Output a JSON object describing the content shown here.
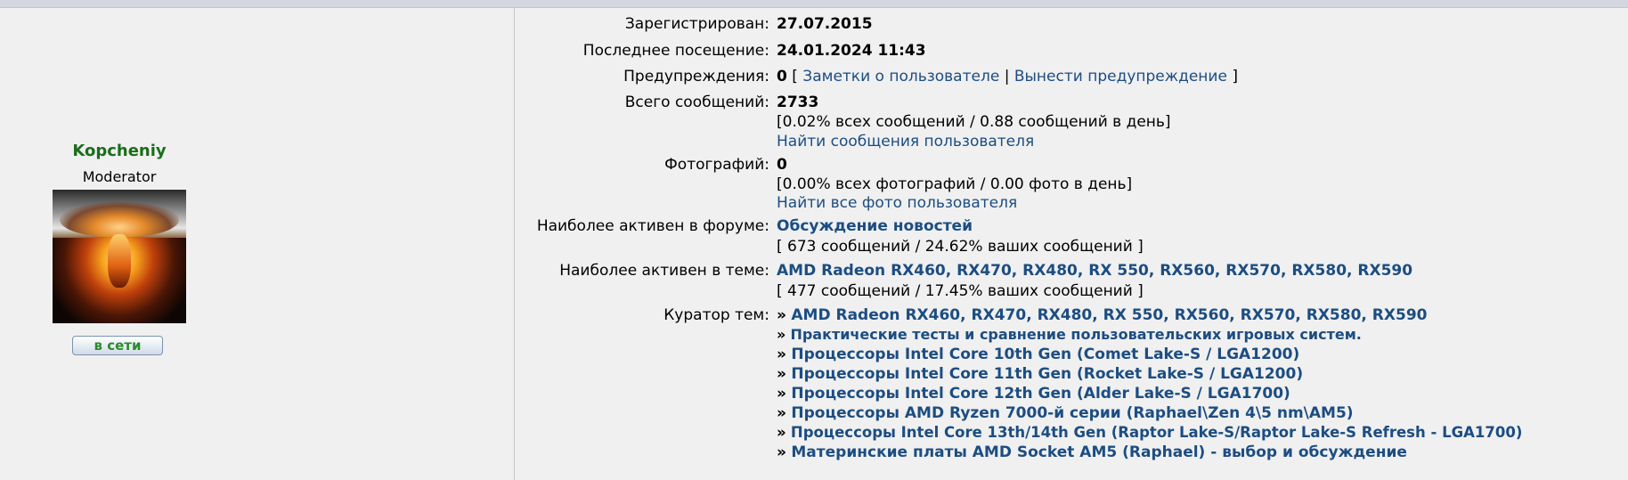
{
  "profile": {
    "username": "Kopcheniy",
    "rank": "Moderator",
    "online_label": "в сети"
  },
  "fields": {
    "registered": {
      "label": "Зарегистрирован:",
      "value": "27.07.2015"
    },
    "last_visit": {
      "label": "Последнее посещение:",
      "value": "24.01.2024 11:43"
    },
    "warnings": {
      "label": "Предупреждения:",
      "value": "0",
      "bracket_open": "[",
      "notes_link": "Заметки о пользователе",
      "separator": "|",
      "warn_link": "Вынести предупреждение",
      "bracket_close": "]"
    },
    "posts": {
      "label": "Всего сообщений:",
      "value": "2733",
      "stats": "[0.02% всех сообщений / 0.88 сообщений в день]",
      "find_link": "Найти сообщения пользователя"
    },
    "photos": {
      "label": "Фотографий:",
      "value": "0",
      "stats": "[0.00% всех фотографий / 0.00 фото в день]",
      "find_link": "Найти все фото пользователя"
    },
    "active_forum": {
      "label": "Наиболее активен в форуме:",
      "link": "Обсуждение новостей",
      "stats": "[ 673 сообщений / 24.62% ваших сообщений ]"
    },
    "active_topic": {
      "label": "Наиболее активен в теме:",
      "link": "AMD Radeon RX460, RX470, RX480, RX 550, RX560, RX570, RX580, RX590",
      "stats": "[ 477 сообщений / 17.45% ваших сообщений ]"
    },
    "curator": {
      "label": "Куратор тем:",
      "bullet": "»",
      "topics": [
        "AMD Radeon RX460, RX470, RX480, RX 550, RX560, RX570, RX580, RX590",
        "Практические тесты и сравнение пользовательских игровых систем.",
        "Процессоры Intel Core 10th Gen (Comet Lake-S / LGA1200)",
        "Процессоры Intel Core 11th Gen (Rocket Lake-S / LGA1200)",
        "Процессоры Intel Core 12th Gen (Alder Lake-S / LGA1700)",
        "Процессоры AMD Ryzen 7000-й серии (Raphael\\Zen 4\\5 nm\\AM5)",
        "Процессоры Intel Core 13th/14th Gen (Raptor Lake-S/Raptor Lake-S Refresh - LGA1700)",
        "Материнские платы AMD Socket AM5 (Raphael) - выбор и обсуждение"
      ]
    }
  }
}
